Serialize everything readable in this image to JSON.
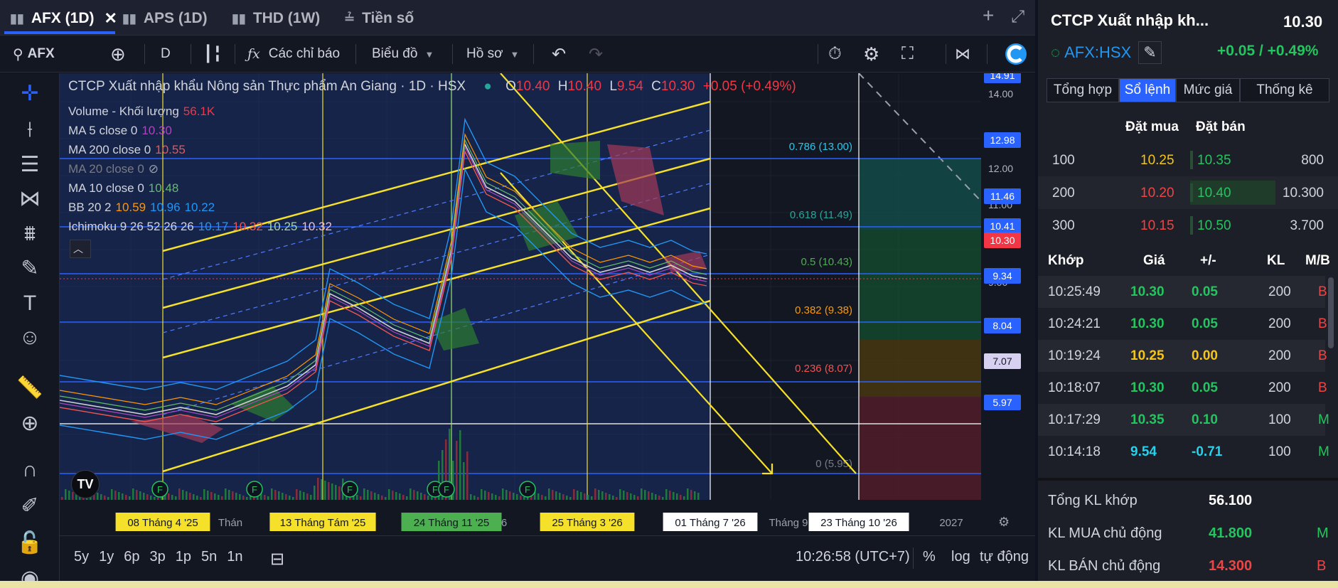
{
  "tabs": [
    {
      "label": "AFX (1D)",
      "icon": "bar-chart-icon"
    },
    {
      "label": "APS (1D)",
      "icon": "bar-chart-icon"
    },
    {
      "label": "THD (1W)",
      "icon": "bar-chart-icon"
    },
    {
      "label": "Tiền số",
      "icon": "list-numbered-icon"
    }
  ],
  "toolbar": {
    "symbol": "AFX",
    "interval": "D",
    "indicators": "Các chỉ báo",
    "chart_type": "Biểu đồ",
    "profile": "Hồ sơ"
  },
  "legend": {
    "title": "CTCP Xuất nhập khẩu Nông sản Thực phẩm An Giang · 1D · HSX",
    "o_label": "O",
    "o": "10.40",
    "h_label": "H",
    "h": "10.40",
    "l_label": "L",
    "l": "9.54",
    "c_label": "C",
    "c": "10.30",
    "change": "+0.05 (+0.49%)",
    "volume_label": "Volume - Khối lượng",
    "volume": "56.1K",
    "ma5_label": "MA 5 close 0",
    "ma5": "10.30",
    "ma200_label": "MA 200 close 0",
    "ma200": "10.55",
    "ma20_label": "MA 20 close 0",
    "ma10_label": "MA 10 close 0",
    "ma10": "10.48",
    "bb_label": "BB 20 2",
    "bb1": "10.59",
    "bb2": "10.96",
    "bb3": "10.22",
    "ichi_label": "Ichimoku 9 26 52 26 26",
    "ichi1": "10.17",
    "ichi2": "10.32",
    "ichi3": "10.25",
    "ichi4": "10.32"
  },
  "fib": [
    {
      "label": "0.786 (13.00)",
      "color": "#2ec4e8"
    },
    {
      "label": "0.618 (11.49)",
      "color": "#26a69a"
    },
    {
      "label": "0.5 (10.43)",
      "color": "#4caf50"
    },
    {
      "label": "0.382 (9.38)",
      "color": "#ff9800"
    },
    {
      "label": "0.236 (8.07)",
      "color": "#ef5350"
    },
    {
      "label": "0 (5.95)",
      "color": "#787b86"
    }
  ],
  "price_scale": {
    "ticks": [
      "14.00",
      "12.00",
      "11.00",
      "10.00",
      "9.00"
    ],
    "badges": [
      {
        "value": "14.91",
        "color": "#2962ff"
      },
      {
        "value": "12.98",
        "color": "#2962ff"
      },
      {
        "value": "11.46",
        "color": "#2962ff"
      },
      {
        "value": "10.41",
        "color": "#2962ff"
      },
      {
        "value": "10.30",
        "color": "#f23645"
      },
      {
        "value": "9.34",
        "color": "#2962ff"
      },
      {
        "value": "8.04",
        "color": "#2962ff"
      },
      {
        "value": "7.07",
        "color": "#d8d0f0"
      },
      {
        "value": "5.97",
        "color": "#2962ff"
      }
    ]
  },
  "time_axis": {
    "labels": [
      {
        "text": "08 Tháng 4 '25",
        "style": "yellow"
      },
      {
        "text": "Thán",
        "style": "plain"
      },
      {
        "text": "13 Tháng Tám '25",
        "style": "yellow"
      },
      {
        "text": "24 Tháng 11 '25",
        "style": "green"
      },
      {
        "text": "6",
        "style": "plain"
      },
      {
        "text": "25 Tháng 3 '26",
        "style": "yellow"
      },
      {
        "text": "01 Tháng 7 '26",
        "style": "white"
      },
      {
        "text": "Tháng 9",
        "style": "plain"
      },
      {
        "text": "23 Tháng 10 '26",
        "style": "white"
      },
      {
        "text": "2027",
        "style": "plain"
      }
    ]
  },
  "bottombar": {
    "ranges": [
      "5y",
      "1y",
      "6p",
      "3p",
      "1p",
      "5n",
      "1n"
    ],
    "time": "10:26:58 (UTC+7)",
    "pct": "%",
    "log": "log",
    "auto": "tự động"
  },
  "quote": {
    "name": "CTCP Xuất nhập kh...",
    "price": "10.30",
    "symbol": "AFX:HSX",
    "change": "+0.05 / +0.49%"
  },
  "subtabs": [
    "Tổng hợp",
    "Sổ lệnh",
    "Mức giá",
    "Thống kê"
  ],
  "orderbook": {
    "bid_header": "Đặt mua",
    "ask_header": "Đặt bán",
    "rows": [
      {
        "bid_vol": "100",
        "bid": "10.25",
        "ask": "10.35",
        "ask_vol": "800"
      },
      {
        "bid_vol": "200",
        "bid": "10.20",
        "ask": "10.40",
        "ask_vol": "10.300"
      },
      {
        "bid_vol": "300",
        "bid": "10.15",
        "ask": "10.50",
        "ask_vol": "3.700"
      }
    ]
  },
  "trades": {
    "headers": [
      "Khớp",
      "Giá",
      "+/-",
      "KL",
      "M/B"
    ],
    "rows": [
      {
        "time": "10:25:49",
        "price": "10.30",
        "chg": "0.05",
        "vol": "200",
        "side": "B",
        "color": "g"
      },
      {
        "time": "10:24:21",
        "price": "10.30",
        "chg": "0.05",
        "vol": "200",
        "side": "B",
        "color": "g"
      },
      {
        "time": "10:19:24",
        "price": "10.25",
        "chg": "0.00",
        "vol": "200",
        "side": "B",
        "color": "y"
      },
      {
        "time": "10:18:07",
        "price": "10.30",
        "chg": "0.05",
        "vol": "200",
        "side": "B",
        "color": "g"
      },
      {
        "time": "10:17:29",
        "price": "10.35",
        "chg": "0.10",
        "vol": "100",
        "side": "M",
        "color": "g"
      },
      {
        "time": "10:14:18",
        "price": "9.54",
        "chg": "-0.71",
        "vol": "100",
        "side": "M",
        "color": "c"
      }
    ]
  },
  "summary": [
    {
      "label": "Tổng KL khớp",
      "value": "56.100",
      "side": ""
    },
    {
      "label": "KL MUA chủ động",
      "value": "41.800",
      "side": "M"
    },
    {
      "label": "KL BÁN chủ động",
      "value": "14.300",
      "side": "B"
    }
  ]
}
